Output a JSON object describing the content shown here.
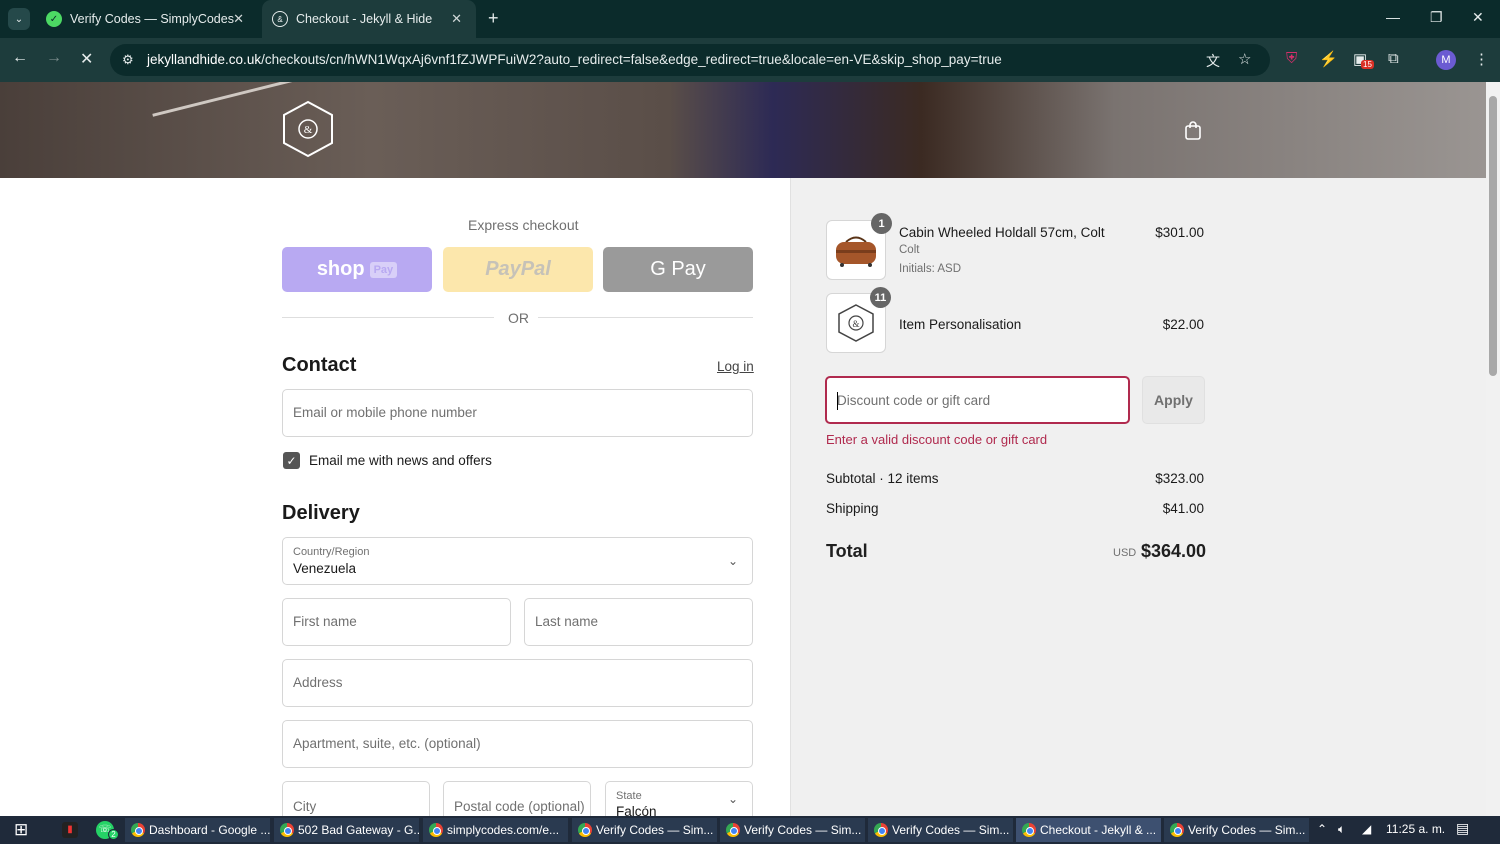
{
  "browser": {
    "tabs": [
      {
        "title": "Verify Codes — SimplyCodes",
        "active": false
      },
      {
        "title": "Checkout - Jekyll & Hide",
        "active": true
      }
    ],
    "url_domain": "jekyllandhide.co.uk",
    "url_path": "/checkouts/cn/hWN1WqxAj6vnf1fZJWPFuiW2?auto_redirect=false&edge_redirect=true&locale=en-VE&skip_shop_pay=true",
    "extension_badge": "15",
    "profile_initial": "M"
  },
  "checkout": {
    "express_label": "Express checkout",
    "shop_pay_label": "shop",
    "shop_pay_badge": "Pay",
    "paypal_label": "PayPal",
    "gpay_label": "G Pay",
    "or_label": "OR",
    "contact_heading": "Contact",
    "login_link": "Log in",
    "email_placeholder": "Email or mobile phone number",
    "newsletter_label": "Email me with news and offers",
    "newsletter_checked": true,
    "delivery_heading": "Delivery",
    "country_label": "Country/Region",
    "country_value": "Venezuela",
    "first_name_placeholder": "First name",
    "last_name_placeholder": "Last name",
    "address_placeholder": "Address",
    "apartment_placeholder": "Apartment, suite, etc. (optional)",
    "city_placeholder": "City",
    "postal_placeholder": "Postal code (optional)",
    "state_label": "State",
    "state_value": "Falcón"
  },
  "summary": {
    "items": [
      {
        "qty": "1",
        "name": "Cabin Wheeled Holdall 57cm, Colt",
        "variant": "Colt",
        "detail": "Initials: ASD",
        "price": "$301.00"
      },
      {
        "qty": "11",
        "name": "Item Personalisation",
        "price": "$22.00"
      }
    ],
    "discount_placeholder": "Discount code or gift card",
    "apply_label": "Apply",
    "error_text": "Enter a valid discount code or gift card",
    "subtotal_label": "Subtotal · 12 items",
    "subtotal_value": "$323.00",
    "shipping_label": "Shipping",
    "shipping_value": "$41.00",
    "total_label": "Total",
    "currency": "USD",
    "total_value": "$364.00",
    "error_color": "#b02a4e"
  },
  "taskbar": {
    "windows": [
      {
        "title": "Dashboard - Google ...",
        "active": false
      },
      {
        "title": "502 Bad Gateway - G...",
        "active": false
      },
      {
        "title": "simplycodes.com/e...",
        "active": false
      },
      {
        "title": "Verify Codes — Sim...",
        "active": false
      },
      {
        "title": "Verify Codes — Sim...",
        "active": false
      },
      {
        "title": "Verify Codes — Sim...",
        "active": false
      },
      {
        "title": "Checkout - Jekyll & ...",
        "active": true
      },
      {
        "title": "Verify Codes — Sim...",
        "active": false
      }
    ],
    "whatsapp_badge": "2",
    "clock": "11:25 a. m."
  }
}
